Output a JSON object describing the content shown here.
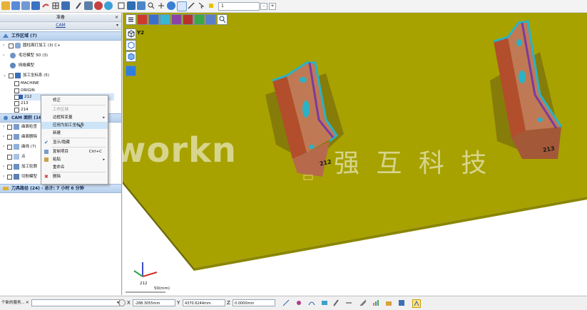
{
  "toolbar": {
    "icons": [
      "open-icon",
      "save-icon",
      "print-icon",
      "undo-icon",
      "redo-icon",
      "grid-icon",
      "view-icon",
      "tool-icon",
      "refresh-icon",
      "color-icon",
      "settings-icon",
      "layer-icon",
      "chart-icon",
      "sphere-icon",
      "zoom-icon",
      "rotate-icon",
      "pan-icon",
      "fit-icon",
      "measure-icon",
      "select-icon"
    ],
    "layer_value": "1"
  },
  "panel": {
    "tab1_label": "准备",
    "tab2_label": "CAM",
    "workzone_title": "工作区域 (7)",
    "workzone_items": [
      {
        "label": "圆柱面打加工 (3) C+",
        "expanded": false,
        "checked": true
      },
      {
        "label": "毛坯模型 3D (3)",
        "expanded": false,
        "checked": false
      },
      {
        "label": "网格模型",
        "expanded": false,
        "checked": false
      },
      {
        "label": "加工坐标系 (5)",
        "expanded": true,
        "checked": true
      }
    ],
    "coord_items": [
      "MACHINE",
      "ORIGIN",
      "212",
      "213",
      "214"
    ],
    "cam_title": "CAM 面积 (16)",
    "cam_items": [
      "曲面检查",
      "曲面删除",
      "曲线 (7)",
      "点",
      "加工轮廓",
      "切削模型"
    ],
    "toolpath_title": "刀具路径 (24) - 总计: 7 小时 6 分钟"
  },
  "context_menu": {
    "items": [
      {
        "label": "修正",
        "type": "normal"
      },
      {
        "sep": true
      },
      {
        "label": "工作区域",
        "type": "disabled"
      },
      {
        "label": "边框和变量",
        "type": "submenu"
      },
      {
        "label": "应用为加工坐标系",
        "type": "highlighted"
      },
      {
        "label": "新建",
        "type": "normal"
      },
      {
        "sep": true
      },
      {
        "label": "显示/隐藏",
        "type": "checked"
      },
      {
        "sep": true
      },
      {
        "label": "复制项目",
        "type": "normal",
        "shortcut": "Ctrl+C"
      },
      {
        "label": "粘贴",
        "type": "submenu"
      },
      {
        "label": "重命名",
        "type": "normal"
      },
      {
        "sep": true
      },
      {
        "label": "删除",
        "type": "normal"
      }
    ]
  },
  "viewport": {
    "toolbar_icons": [
      "menu-icon",
      "red-cube-icon",
      "blue-cube-icon",
      "cyan-cube-icon",
      "purple-cube-icon",
      "red-solid-icon",
      "green-cube-icon",
      "transform-icon",
      "zoom-person-icon"
    ],
    "side_icons": [
      "view-cube-icon",
      "wireframe-cube-icon",
      "shaded-cube-icon"
    ],
    "axis_y_label": "Y2",
    "part_labels": [
      "212",
      "213"
    ],
    "watermark": "workn",
    "watermark_cn": "强 互 科 技",
    "triad_label": "212",
    "scale_label": "50(mm)",
    "colors": {
      "plate": "#a5a200",
      "part_body": "#b66a4b",
      "edge": "#2bb2c4",
      "shadow": "#6b5d11"
    }
  },
  "status": {
    "selection_label": "个新的服务...",
    "x_label": "X",
    "x_value": "-288.3055mm",
    "y_label": "Y",
    "y_value": "4370.6244mm",
    "z_label": "Z",
    "z_value": "0.0000mm",
    "icons": [
      "snap-icon",
      "point-icon",
      "curve-icon",
      "surface-icon",
      "tool-icon",
      "line-icon",
      "measure-icon",
      "chart-icon",
      "folder-icon",
      "save-icon",
      "highlight-icon"
    ]
  }
}
